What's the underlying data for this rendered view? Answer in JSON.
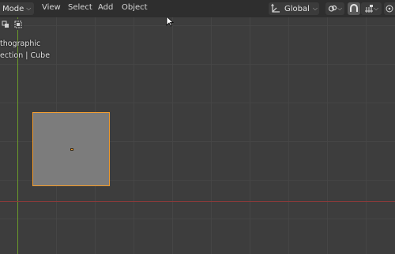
{
  "header": {
    "mode_label": "Mode",
    "menus": [
      "View",
      "Select",
      "Add",
      "Object"
    ],
    "orientation_label": "Global"
  },
  "viewport_overlay": {
    "view_name": "thographic",
    "collection_object": "ection | Cube"
  },
  "colors": {
    "selection_outline": "#f39b2b",
    "x_axis": "#8a3a3a",
    "y_axis": "#6b9a2a",
    "background": "#3d3d3d",
    "header": "#2e2e2e"
  },
  "icons": {
    "transform_orientation": "orientation-gizmo-icon",
    "pivot": "link-icon",
    "snap": "magnet-icon",
    "snap_increment": "snap-grid-icon"
  }
}
